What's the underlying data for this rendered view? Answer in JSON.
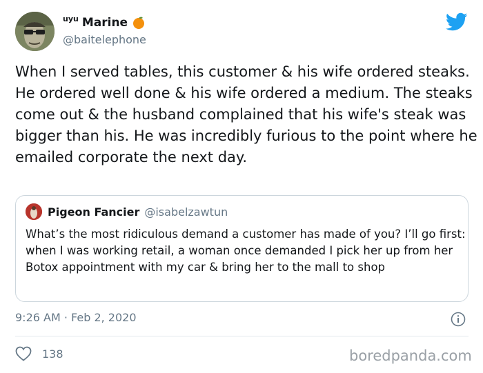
{
  "author": {
    "name_prefix": "uyu",
    "display_name": "Marine",
    "emoji_icon": "orange-icon",
    "handle": "@baitelephone"
  },
  "tweet": {
    "text": "When I served tables, this customer & his wife ordered steaks. He ordered well done & his wife ordered a medium. The steaks come out & the husband complained that his wife's steak was bigger than his. He was incredibly furious to the point where he emailed corporate the next day."
  },
  "quoted_tweet": {
    "display_name": "Pigeon Fancier",
    "handle": "@isabelzawtun",
    "text": "What’s the most ridiculous demand a customer has made of you? I’ll go first: when I was working retail, a woman once demanded I pick her up from her Botox appointment with my car & bring her to the mall to shop"
  },
  "meta": {
    "timestamp": "9:26 AM · Feb 2, 2020"
  },
  "actions": {
    "like_count": "138"
  },
  "watermark": "boredpanda.com",
  "colors": {
    "twitter_blue": "#1da1f2",
    "secondary_text": "#657786",
    "border": "#ccd6dd"
  }
}
